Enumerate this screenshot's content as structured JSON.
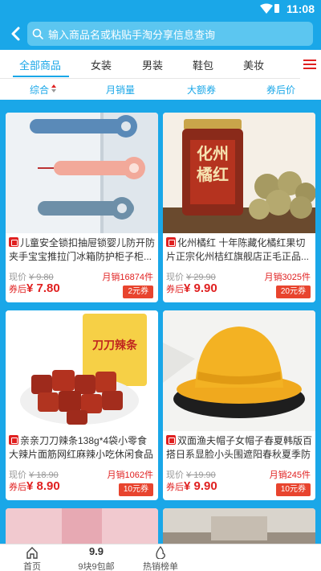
{
  "status_bar": {
    "time": "11:08"
  },
  "search": {
    "placeholder": "输入商品名或粘贴手淘分享信息查询"
  },
  "categories": [
    {
      "label": "全部商品",
      "active": true
    },
    {
      "label": "女装",
      "active": false
    },
    {
      "label": "男装",
      "active": false
    },
    {
      "label": "鞋包",
      "active": false
    },
    {
      "label": "美妆",
      "active": false
    }
  ],
  "sort_options": [
    {
      "label": "综合",
      "active": true
    },
    {
      "label": "月销量"
    },
    {
      "label": "大额券"
    },
    {
      "label": "券后价"
    }
  ],
  "products": [
    {
      "title": "儿童安全锁扣抽屉锁婴儿防开防夹手宝宝推拉门冰箱防护柜子柜...",
      "orig_label": "现价",
      "orig_price": "¥ 9.80",
      "sales": "月销16874件",
      "after_label": "券后",
      "after_price": "¥ 7.80",
      "coupon": "2元券"
    },
    {
      "title": "化州橘红 十年陈藏化橘红果切片正宗化州桔红旗舰店正毛正品...",
      "orig_label": "现价",
      "orig_price": "¥ 29.90",
      "sales": "月销3025件",
      "after_label": "券后",
      "after_price": "¥ 9.90",
      "coupon": "20元券",
      "image_text": "化州橘红"
    },
    {
      "title": "亲亲刀刀辣条138g*4袋小零食大辣片面筋网红麻辣小吃休闲食品",
      "orig_label": "现价",
      "orig_price": "¥ 18.90",
      "sales": "月销1062件",
      "after_label": "券后",
      "after_price": "¥ 8.90",
      "coupon": "10元券",
      "image_text": "刀刀辣条"
    },
    {
      "title": "双面渔夫帽子女帽子春夏韩版百搭日系显脸小头围遮阳春秋夏季防晒",
      "orig_label": "现价",
      "orig_price": "¥ 19.90",
      "sales": "月销245件",
      "after_label": "券后",
      "after_price": "¥ 9.90",
      "coupon": "10元券"
    }
  ],
  "tabbar": [
    {
      "label": "首页",
      "icon": "home-icon"
    },
    {
      "label": "9块9包邮",
      "icon_text": "9.9"
    },
    {
      "label": "热销榜单",
      "icon": "hot-icon"
    }
  ],
  "colors": {
    "accent": "#1aa7e8",
    "price_red": "#e02020",
    "coupon_bg": "#e8442e"
  }
}
